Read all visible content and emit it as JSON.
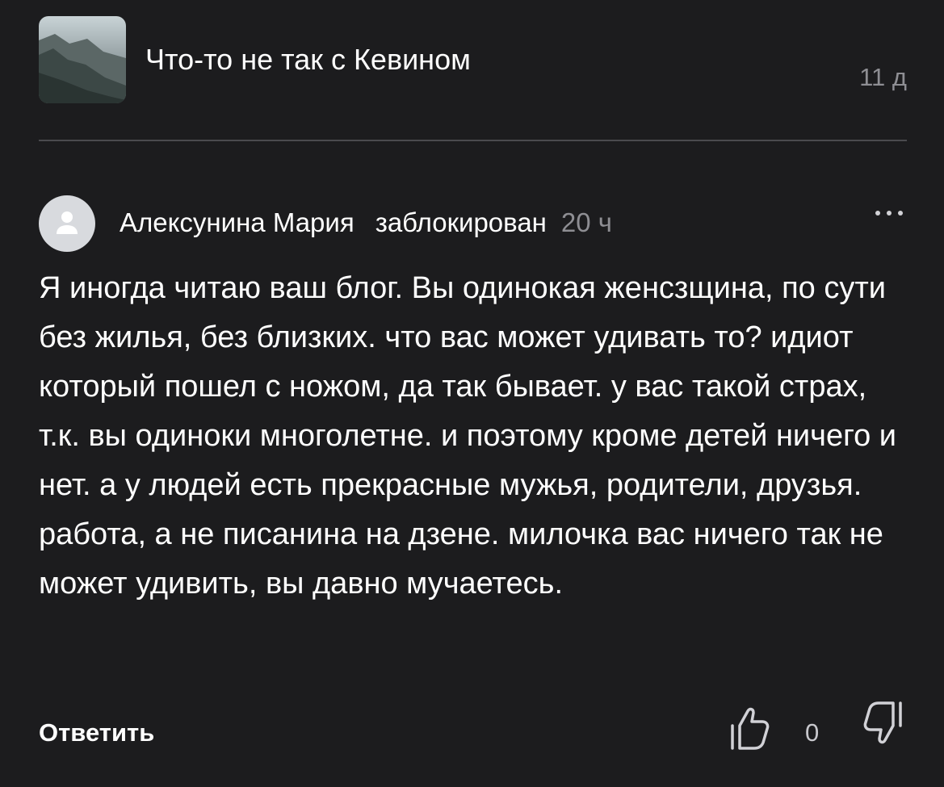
{
  "post": {
    "title": "Что-то не так с Кевином",
    "age": "11 д",
    "thumbnail_icon": "mountain-landscape-thumbnail"
  },
  "comment": {
    "author": "Алексунина Мария",
    "status": "заблокирован",
    "age": "20 ч",
    "avatar_icon": "user-avatar-icon",
    "more_icon": "more-dots-icon",
    "text": "Я иногда читаю ваш блог. Вы одинокая женсзщина, по сути без жилья, без близких. что вас может удивать то? идиот который пошел с ножом, да так бывает. у вас такой страх, т.к. вы одиноки многолетне. и поэтому кроме детей ничего и нет. а у людей есть прекрасные мужья, родители, друзья. работа, а не писанина на дзене. милочка вас ничего так не может удивить, вы давно мучаетесь."
  },
  "actions": {
    "reply_label": "Ответить",
    "like_icon": "thumbs-up-icon",
    "like_count": "0",
    "dislike_icon": "thumbs-down-icon"
  },
  "colors": {
    "background": "#1c1c1e",
    "text": "#ffffff",
    "muted": "#8e8e93",
    "divider": "#4a4a4e"
  }
}
